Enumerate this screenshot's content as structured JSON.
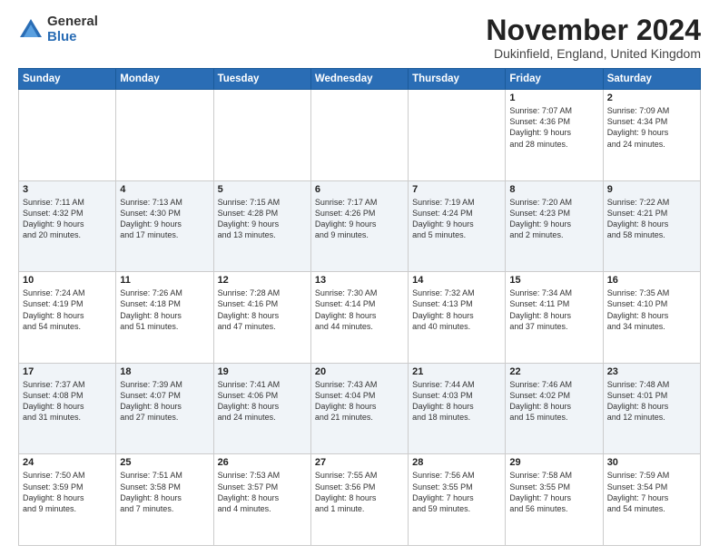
{
  "logo": {
    "general": "General",
    "blue": "Blue"
  },
  "title": "November 2024",
  "location": "Dukinfield, England, United Kingdom",
  "days_header": [
    "Sunday",
    "Monday",
    "Tuesday",
    "Wednesday",
    "Thursday",
    "Friday",
    "Saturday"
  ],
  "weeks": [
    [
      {
        "day": "",
        "info": ""
      },
      {
        "day": "",
        "info": ""
      },
      {
        "day": "",
        "info": ""
      },
      {
        "day": "",
        "info": ""
      },
      {
        "day": "",
        "info": ""
      },
      {
        "day": "1",
        "info": "Sunrise: 7:07 AM\nSunset: 4:36 PM\nDaylight: 9 hours\nand 28 minutes."
      },
      {
        "day": "2",
        "info": "Sunrise: 7:09 AM\nSunset: 4:34 PM\nDaylight: 9 hours\nand 24 minutes."
      }
    ],
    [
      {
        "day": "3",
        "info": "Sunrise: 7:11 AM\nSunset: 4:32 PM\nDaylight: 9 hours\nand 20 minutes."
      },
      {
        "day": "4",
        "info": "Sunrise: 7:13 AM\nSunset: 4:30 PM\nDaylight: 9 hours\nand 17 minutes."
      },
      {
        "day": "5",
        "info": "Sunrise: 7:15 AM\nSunset: 4:28 PM\nDaylight: 9 hours\nand 13 minutes."
      },
      {
        "day": "6",
        "info": "Sunrise: 7:17 AM\nSunset: 4:26 PM\nDaylight: 9 hours\nand 9 minutes."
      },
      {
        "day": "7",
        "info": "Sunrise: 7:19 AM\nSunset: 4:24 PM\nDaylight: 9 hours\nand 5 minutes."
      },
      {
        "day": "8",
        "info": "Sunrise: 7:20 AM\nSunset: 4:23 PM\nDaylight: 9 hours\nand 2 minutes."
      },
      {
        "day": "9",
        "info": "Sunrise: 7:22 AM\nSunset: 4:21 PM\nDaylight: 8 hours\nand 58 minutes."
      }
    ],
    [
      {
        "day": "10",
        "info": "Sunrise: 7:24 AM\nSunset: 4:19 PM\nDaylight: 8 hours\nand 54 minutes."
      },
      {
        "day": "11",
        "info": "Sunrise: 7:26 AM\nSunset: 4:18 PM\nDaylight: 8 hours\nand 51 minutes."
      },
      {
        "day": "12",
        "info": "Sunrise: 7:28 AM\nSunset: 4:16 PM\nDaylight: 8 hours\nand 47 minutes."
      },
      {
        "day": "13",
        "info": "Sunrise: 7:30 AM\nSunset: 4:14 PM\nDaylight: 8 hours\nand 44 minutes."
      },
      {
        "day": "14",
        "info": "Sunrise: 7:32 AM\nSunset: 4:13 PM\nDaylight: 8 hours\nand 40 minutes."
      },
      {
        "day": "15",
        "info": "Sunrise: 7:34 AM\nSunset: 4:11 PM\nDaylight: 8 hours\nand 37 minutes."
      },
      {
        "day": "16",
        "info": "Sunrise: 7:35 AM\nSunset: 4:10 PM\nDaylight: 8 hours\nand 34 minutes."
      }
    ],
    [
      {
        "day": "17",
        "info": "Sunrise: 7:37 AM\nSunset: 4:08 PM\nDaylight: 8 hours\nand 31 minutes."
      },
      {
        "day": "18",
        "info": "Sunrise: 7:39 AM\nSunset: 4:07 PM\nDaylight: 8 hours\nand 27 minutes."
      },
      {
        "day": "19",
        "info": "Sunrise: 7:41 AM\nSunset: 4:06 PM\nDaylight: 8 hours\nand 24 minutes."
      },
      {
        "day": "20",
        "info": "Sunrise: 7:43 AM\nSunset: 4:04 PM\nDaylight: 8 hours\nand 21 minutes."
      },
      {
        "day": "21",
        "info": "Sunrise: 7:44 AM\nSunset: 4:03 PM\nDaylight: 8 hours\nand 18 minutes."
      },
      {
        "day": "22",
        "info": "Sunrise: 7:46 AM\nSunset: 4:02 PM\nDaylight: 8 hours\nand 15 minutes."
      },
      {
        "day": "23",
        "info": "Sunrise: 7:48 AM\nSunset: 4:01 PM\nDaylight: 8 hours\nand 12 minutes."
      }
    ],
    [
      {
        "day": "24",
        "info": "Sunrise: 7:50 AM\nSunset: 3:59 PM\nDaylight: 8 hours\nand 9 minutes."
      },
      {
        "day": "25",
        "info": "Sunrise: 7:51 AM\nSunset: 3:58 PM\nDaylight: 8 hours\nand 7 minutes."
      },
      {
        "day": "26",
        "info": "Sunrise: 7:53 AM\nSunset: 3:57 PM\nDaylight: 8 hours\nand 4 minutes."
      },
      {
        "day": "27",
        "info": "Sunrise: 7:55 AM\nSunset: 3:56 PM\nDaylight: 8 hours\nand 1 minute."
      },
      {
        "day": "28",
        "info": "Sunrise: 7:56 AM\nSunset: 3:55 PM\nDaylight: 7 hours\nand 59 minutes."
      },
      {
        "day": "29",
        "info": "Sunrise: 7:58 AM\nSunset: 3:55 PM\nDaylight: 7 hours\nand 56 minutes."
      },
      {
        "day": "30",
        "info": "Sunrise: 7:59 AM\nSunset: 3:54 PM\nDaylight: 7 hours\nand 54 minutes."
      }
    ]
  ]
}
